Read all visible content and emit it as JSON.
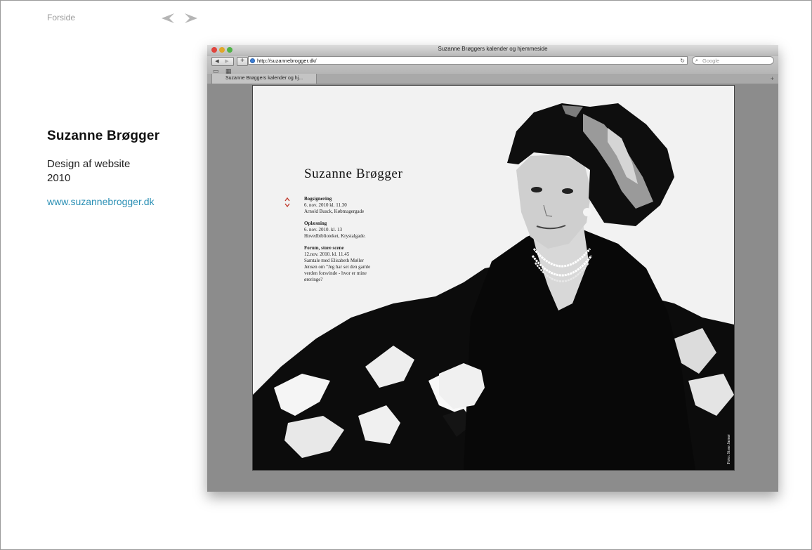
{
  "nav": {
    "home_label": "Forside"
  },
  "project": {
    "title": "Suzanne Brøgger",
    "subtitle_line1": "Design af website",
    "subtitle_line2": "2010",
    "link": "www.suzannebrogger.dk"
  },
  "browser": {
    "window_title": "Suzanne Brøggers kalender og hjemmeside",
    "url": "http://suzannebrogger.dk/",
    "search_placeholder": "Google",
    "tab_label": "Suzanne Brøggers kalender og hj..."
  },
  "website": {
    "title": "Suzanne Brøgger",
    "events": [
      {
        "title": "Bogsignering",
        "lines": [
          "6. nov. 2010 kl. 11.30",
          "Arnold Busck, Købmagergade"
        ]
      },
      {
        "title": "Oplæsning",
        "lines": [
          "6. nov. 2010. kl. 13",
          "Hovedbiblioteket, Krystalgade."
        ]
      },
      {
        "title": "Forum, store scene",
        "lines": [
          "12.nov. 2010. kl. 11.45",
          "Samtale med Elisabeth Møller",
          "Jensen om \"Jeg har set den gamle",
          "verden forsvinde - hvor er mine",
          "øreringe?"
        ]
      }
    ],
    "photo_credit": "Foto: Sisse Jarner"
  },
  "colors": {
    "link": "#2c90b5",
    "accent_red": "#c0392b"
  }
}
